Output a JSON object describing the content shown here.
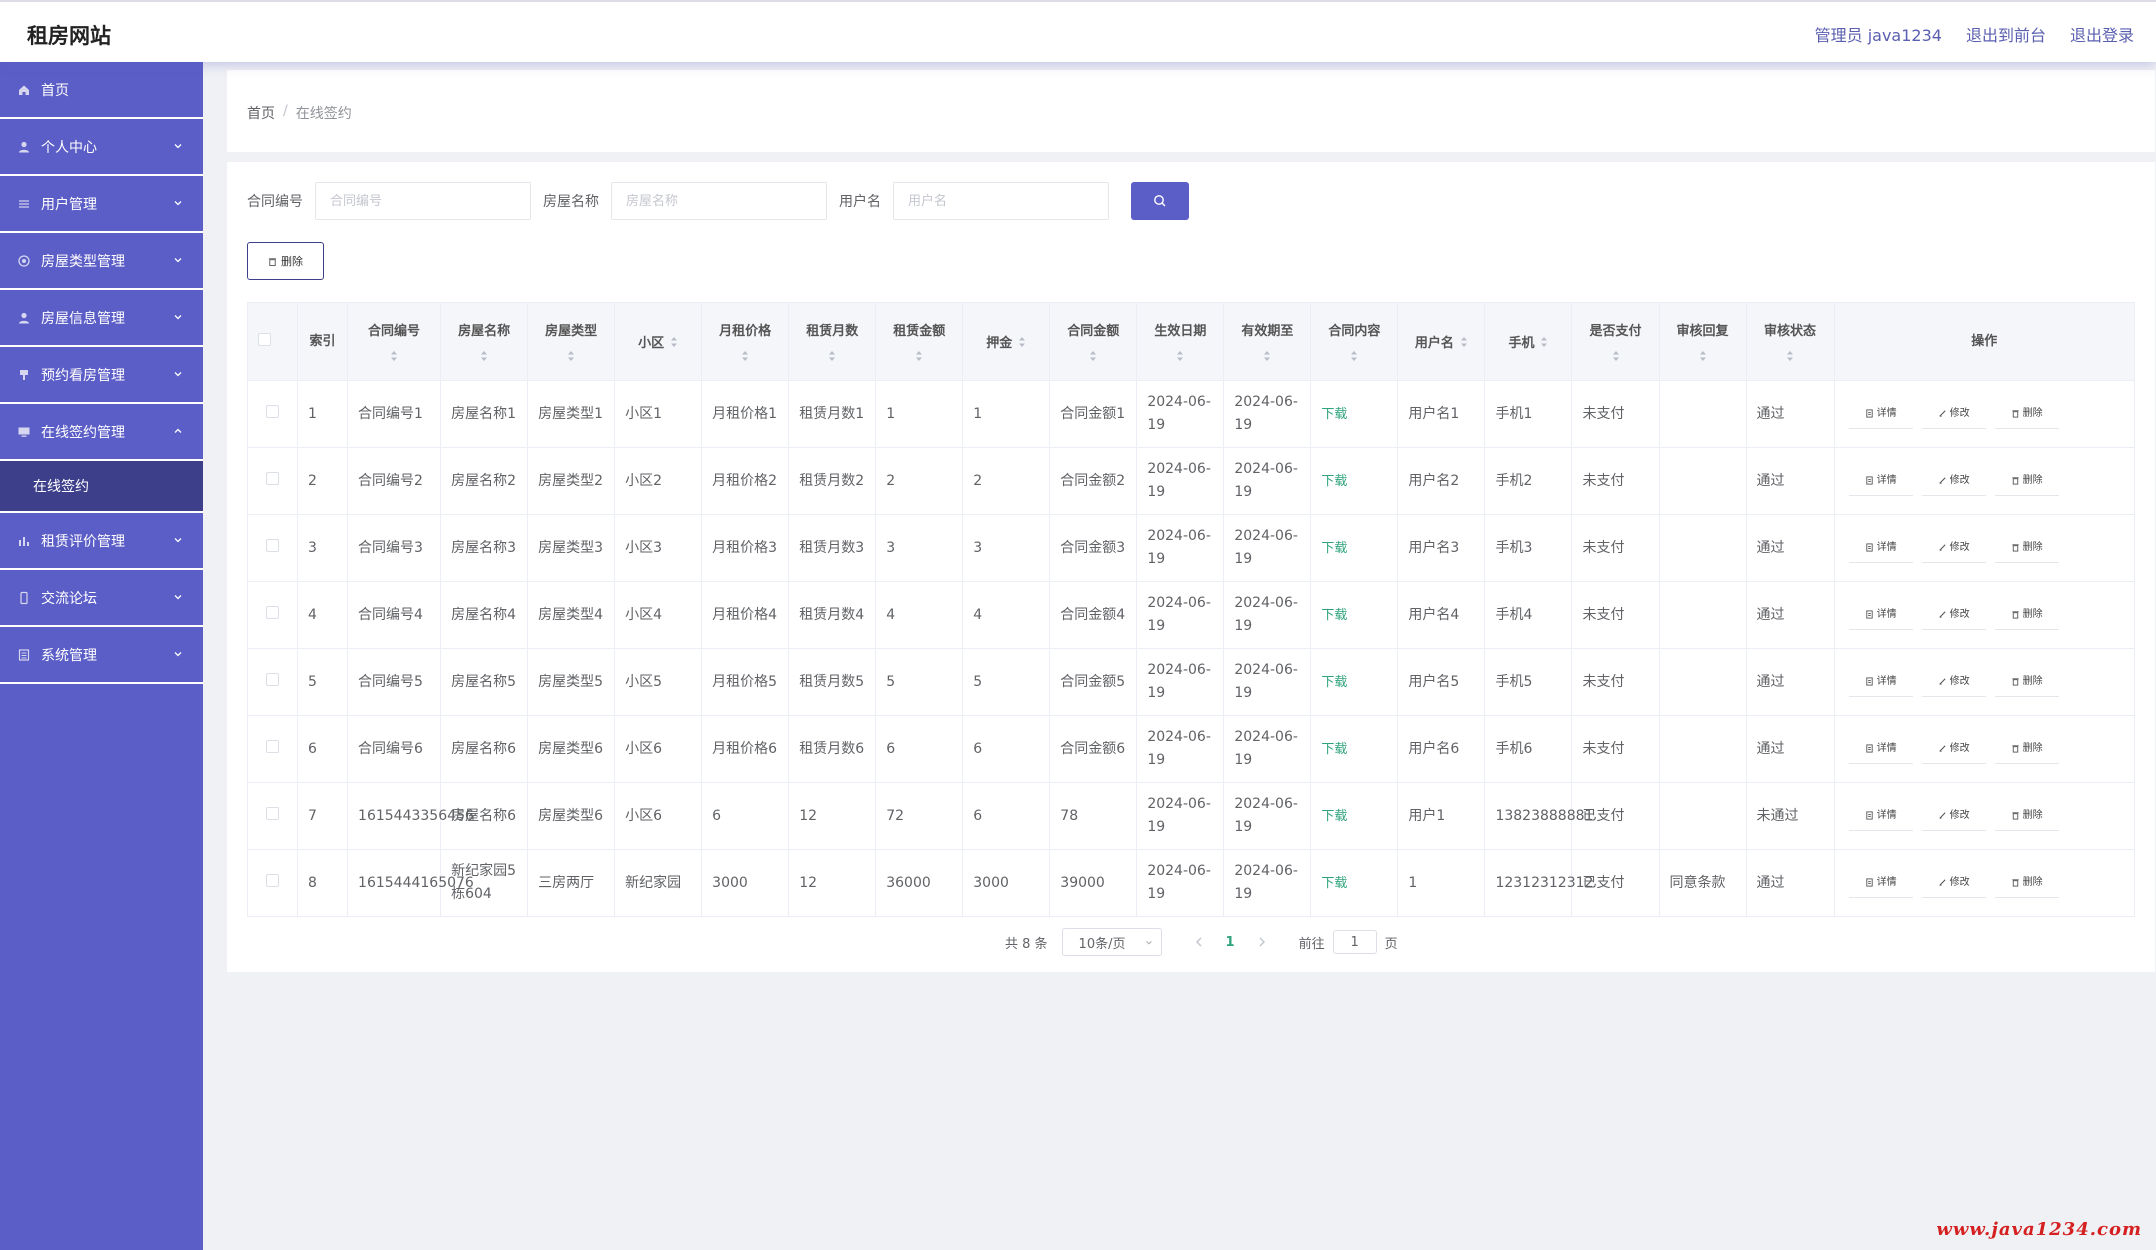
{
  "app": {
    "title": "租房网站"
  },
  "header": {
    "admin_label": "管理员 java1234",
    "front_label": "退出到前台",
    "logout_label": "退出登录"
  },
  "sidebar": {
    "items": [
      {
        "label": "首页",
        "icon": "home-icon",
        "expandable": false
      },
      {
        "label": "个人中心",
        "icon": "user-icon",
        "expandable": true
      },
      {
        "label": "用户管理",
        "icon": "sliders-icon",
        "expandable": true
      },
      {
        "label": "房屋类型管理",
        "icon": "circle-icon",
        "expandable": true
      },
      {
        "label": "房屋信息管理",
        "icon": "user-icon",
        "expandable": true
      },
      {
        "label": "预约看房管理",
        "icon": "brush-icon",
        "expandable": true
      },
      {
        "label": "在线签约管理",
        "icon": "monitor-icon",
        "expandable": true,
        "open": true
      },
      {
        "label": "租赁评价管理",
        "icon": "bar-chart-icon",
        "expandable": true
      },
      {
        "label": "交流论坛",
        "icon": "phone-icon",
        "expandable": true
      },
      {
        "label": "系统管理",
        "icon": "list-icon",
        "expandable": true
      }
    ],
    "submenu_active": "在线签约"
  },
  "breadcrumb": {
    "home": "首页",
    "separator": "/",
    "current": "在线签约"
  },
  "search": {
    "contract_label": "合同编号",
    "contract_placeholder": "合同编号",
    "house_label": "房屋名称",
    "house_placeholder": "房屋名称",
    "user_label": "用户名",
    "user_placeholder": "用户名"
  },
  "toolbar": {
    "delete_label": "删除"
  },
  "table": {
    "headers": {
      "index": "索引",
      "contract_no": "合同编号",
      "house_name": "房屋名称",
      "house_type": "房屋类型",
      "community": "小区",
      "monthly_rent": "月租价格",
      "months": "租赁月数",
      "rent_amount": "租赁金额",
      "deposit": "押金",
      "contract_amount": "合同金额",
      "start_date": "生效日期",
      "end_date": "有效期至",
      "content": "合同内容",
      "username": "用户名",
      "phone": "手机",
      "paid": "是否支付",
      "reply": "审核回复",
      "status": "审核状态",
      "actions": "操作"
    },
    "rows": [
      {
        "index": "1",
        "contract_no": "合同编号1",
        "house_name": "房屋名称1",
        "house_type": "房屋类型1",
        "community": "小区1",
        "monthly_rent": "月租价格1",
        "months": "租赁月数1",
        "rent_amount": "1",
        "deposit": "1",
        "contract_amount": "合同金额1",
        "start_date": "2024-06-19",
        "end_date": "2024-06-19",
        "content": "下载",
        "username": "用户名1",
        "phone": "手机1",
        "paid": "未支付",
        "reply": "",
        "status": "通过"
      },
      {
        "index": "2",
        "contract_no": "合同编号2",
        "house_name": "房屋名称2",
        "house_type": "房屋类型2",
        "community": "小区2",
        "monthly_rent": "月租价格2",
        "months": "租赁月数2",
        "rent_amount": "2",
        "deposit": "2",
        "contract_amount": "合同金额2",
        "start_date": "2024-06-19",
        "end_date": "2024-06-19",
        "content": "下载",
        "username": "用户名2",
        "phone": "手机2",
        "paid": "未支付",
        "reply": "",
        "status": "通过"
      },
      {
        "index": "3",
        "contract_no": "合同编号3",
        "house_name": "房屋名称3",
        "house_type": "房屋类型3",
        "community": "小区3",
        "monthly_rent": "月租价格3",
        "months": "租赁月数3",
        "rent_amount": "3",
        "deposit": "3",
        "contract_amount": "合同金额3",
        "start_date": "2024-06-19",
        "end_date": "2024-06-19",
        "content": "下载",
        "username": "用户名3",
        "phone": "手机3",
        "paid": "未支付",
        "reply": "",
        "status": "通过"
      },
      {
        "index": "4",
        "contract_no": "合同编号4",
        "house_name": "房屋名称4",
        "house_type": "房屋类型4",
        "community": "小区4",
        "monthly_rent": "月租价格4",
        "months": "租赁月数4",
        "rent_amount": "4",
        "deposit": "4",
        "contract_amount": "合同金额4",
        "start_date": "2024-06-19",
        "end_date": "2024-06-19",
        "content": "下载",
        "username": "用户名4",
        "phone": "手机4",
        "paid": "未支付",
        "reply": "",
        "status": "通过"
      },
      {
        "index": "5",
        "contract_no": "合同编号5",
        "house_name": "房屋名称5",
        "house_type": "房屋类型5",
        "community": "小区5",
        "monthly_rent": "月租价格5",
        "months": "租赁月数5",
        "rent_amount": "5",
        "deposit": "5",
        "contract_amount": "合同金额5",
        "start_date": "2024-06-19",
        "end_date": "2024-06-19",
        "content": "下载",
        "username": "用户名5",
        "phone": "手机5",
        "paid": "未支付",
        "reply": "",
        "status": "通过"
      },
      {
        "index": "6",
        "contract_no": "合同编号6",
        "house_name": "房屋名称6",
        "house_type": "房屋类型6",
        "community": "小区6",
        "monthly_rent": "月租价格6",
        "months": "租赁月数6",
        "rent_amount": "6",
        "deposit": "6",
        "contract_amount": "合同金额6",
        "start_date": "2024-06-19",
        "end_date": "2024-06-19",
        "content": "下载",
        "username": "用户名6",
        "phone": "手机6",
        "paid": "未支付",
        "reply": "",
        "status": "通过"
      },
      {
        "index": "7",
        "contract_no": "1615443356456",
        "house_name": "房屋名称6",
        "house_type": "房屋类型6",
        "community": "小区6",
        "monthly_rent": "6",
        "months": "12",
        "rent_amount": "72",
        "deposit": "6",
        "contract_amount": "78",
        "start_date": "2024-06-19",
        "end_date": "2024-06-19",
        "content": "下载",
        "username": "用户1",
        "phone": "13823888881",
        "paid": "已支付",
        "reply": "",
        "status": "未通过"
      },
      {
        "index": "8",
        "contract_no": "1615444165076",
        "house_name": "新纪家园5栋604",
        "house_type": "三房两厅",
        "community": "新纪家园",
        "monthly_rent": "3000",
        "months": "12",
        "rent_amount": "36000",
        "deposit": "3000",
        "contract_amount": "39000",
        "start_date": "2024-06-19",
        "end_date": "2024-06-19",
        "content": "下载",
        "username": "1",
        "phone": "12312312312",
        "paid": "已支付",
        "reply": "同意条款",
        "status": "通过"
      }
    ],
    "action_labels": {
      "detail": "详情",
      "edit": "修改",
      "delete": "删除"
    }
  },
  "pagination": {
    "total_label": "共 8 条",
    "page_size": "10条/页",
    "current_page": "1",
    "goto_prefix": "前往",
    "goto_value": "1",
    "goto_suffix": "页"
  },
  "watermark": "www.java1234.com",
  "colors": {
    "accent": "#5c5ec7",
    "accent_dark": "#3d3f8a",
    "link_green": "#2fa37c",
    "watermark_red": "#d42020"
  }
}
